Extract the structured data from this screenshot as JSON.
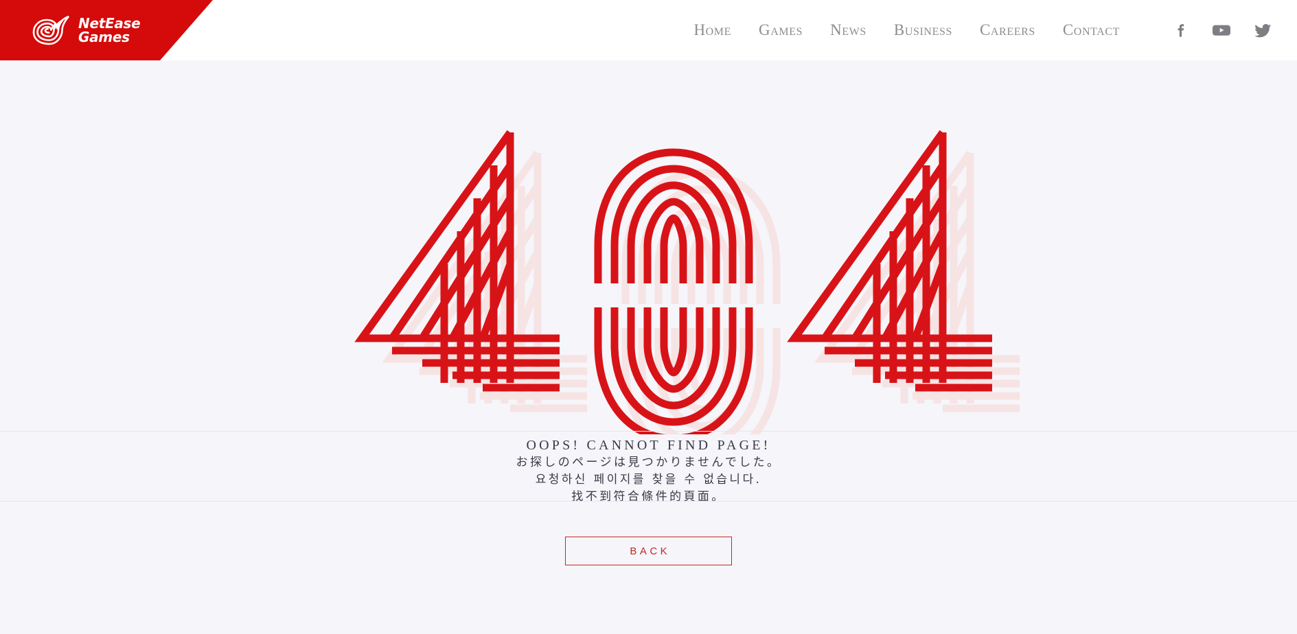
{
  "header": {
    "logo": {
      "mark_icon": "netease-swirl-icon",
      "line1": "NetEase",
      "line2": "Games"
    },
    "nav": [
      {
        "label": "Home"
      },
      {
        "label": "Games"
      },
      {
        "label": "News"
      },
      {
        "label": "Business"
      },
      {
        "label": "Careers"
      },
      {
        "label": "Contact"
      }
    ],
    "social": [
      {
        "name": "facebook-icon"
      },
      {
        "name": "youtube-icon"
      },
      {
        "name": "twitter-icon"
      }
    ]
  },
  "error": {
    "code": "404",
    "messages": {
      "en": "OOPS! CANNOT FIND PAGE!",
      "ja": "お探しのページは見つかりませんでした。",
      "ko": "요청하신 페이지를 찾을 수 없습니다.",
      "zh": "找不到符合條件的頁面。"
    },
    "back_label": "BACK"
  },
  "colors": {
    "brand_red": "#d50a0a",
    "graphic_red": "#d81317",
    "graphic_shadow": "#f6e3e3",
    "background": "#f5f5fa",
    "nav_text": "#8c8c92",
    "body_text": "#3a3a48",
    "divider": "#e6e6ec",
    "button_border": "#c9281f"
  }
}
